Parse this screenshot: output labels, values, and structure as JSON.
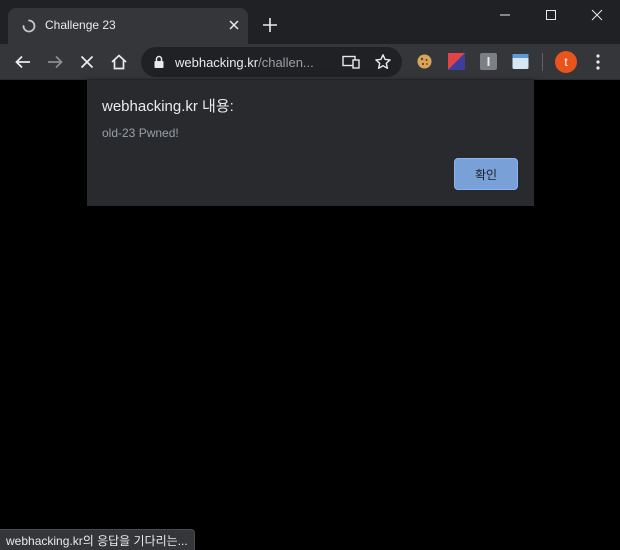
{
  "tab": {
    "title": "Challenge 23"
  },
  "omnibox": {
    "host": "webhacking.kr",
    "path": "/challen..."
  },
  "profile": {
    "initial": "t"
  },
  "dialog": {
    "title": "webhacking.kr 내용:",
    "message": "old-23 Pwned!",
    "ok_label": "확인"
  },
  "status_bar": {
    "text": "webhacking.kr의 응답을 기다리는..."
  },
  "colors": {
    "accent": "#8ab4f8",
    "avatar": "#e8541c",
    "frame": "#202124",
    "toolbar": "#35363a"
  },
  "icons": [
    "loading-spinner-icon",
    "close-icon",
    "plus-icon",
    "minimize-icon",
    "maximize-icon",
    "back-icon",
    "forward-icon",
    "stop-icon",
    "home-icon",
    "lock-icon",
    "cast-icon",
    "star-icon",
    "cookie-icon",
    "menu-icon"
  ]
}
